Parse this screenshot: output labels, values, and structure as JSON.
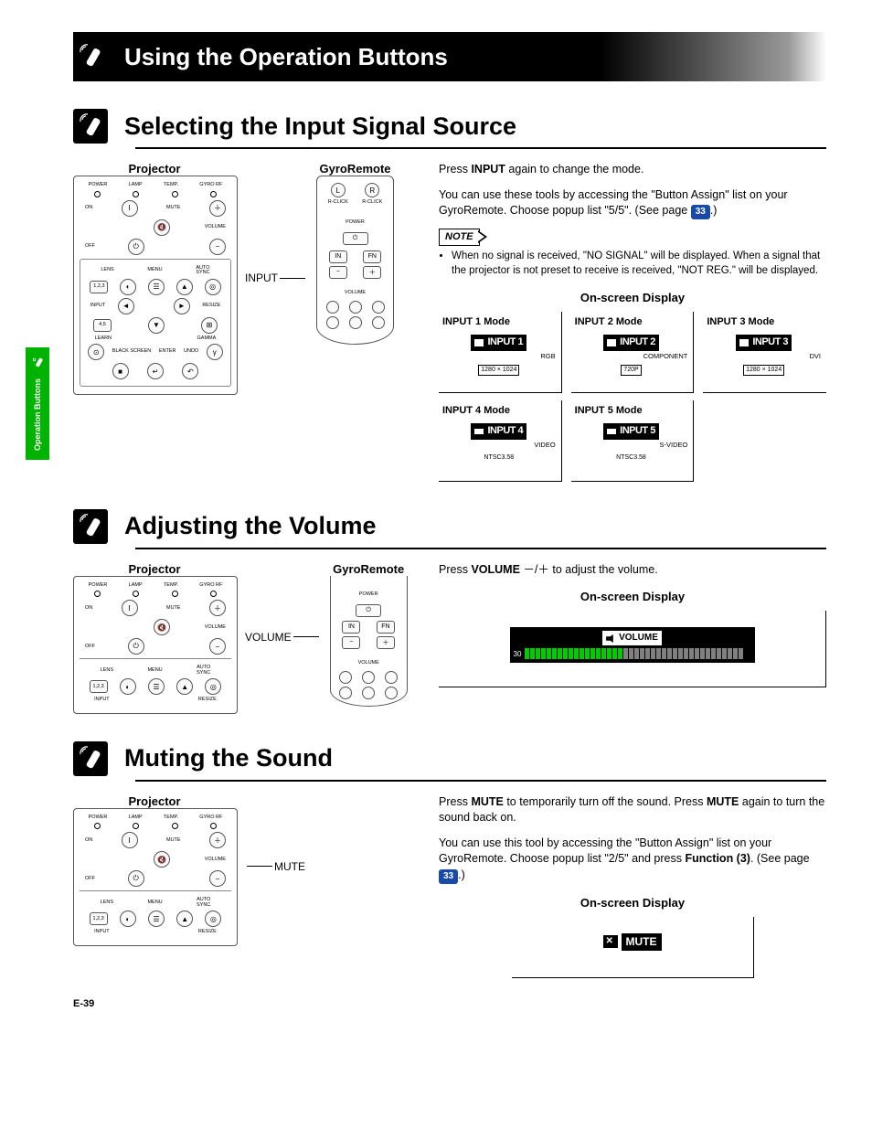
{
  "sideTab": "Operation Buttons",
  "mainTitle": "Using the Operation Buttons",
  "pageNum": "E-39",
  "pageRef": "33",
  "section1": {
    "title": "Selecting the Input Signal Source",
    "projectorLabel": "Projector",
    "remoteLabel": "GyroRemote",
    "pointer": "INPUT",
    "proj": {
      "ind": [
        "POWER",
        "LAMP",
        "TEMP.",
        "GYRO RF"
      ],
      "on": "ON",
      "mute": "MUTE",
      "volume": "VOLUME",
      "off": "OFF",
      "lens": "LENS",
      "menu": "MENU",
      "autosync": "AUTO\nSYNC",
      "input": "INPUT",
      "resize": "RESIZE",
      "learn": "LEARN",
      "gamma": "GAMMA",
      "black": "BLACK SCREEN",
      "enter": "ENTER",
      "undo": "UNDO",
      "n123": "1,2,3",
      "n45": "4,5"
    },
    "body": {
      "p1a": "Press ",
      "p1b": "INPUT",
      "p1c": " again to change the mode.",
      "p2": "You can use these tools by accessing the \"Button Assign\" list on your GyroRemote. Choose popup list \"5/5\". (See page ",
      "p2end": ".)",
      "note": "NOTE",
      "bullet": "When no signal is received, \"NO SIGNAL\" will be displayed. When a signal that the projector is not preset to receive is received, \"NOT REG.\" will be displayed.",
      "osdTitle": "On-screen Display",
      "modes": [
        {
          "head": "INPUT 1 Mode",
          "chip": "INPUT 1",
          "sub1": "RGB",
          "sub2": "1280 × 1024"
        },
        {
          "head": "INPUT 2 Mode",
          "chip": "INPUT 2",
          "sub1": "COMPONENT",
          "sub2": "720P"
        },
        {
          "head": "INPUT 3 Mode",
          "chip": "INPUT 3",
          "sub1": "DVI",
          "sub2": "1280 × 1024"
        },
        {
          "head": "INPUT 4 Mode",
          "chip": "INPUT 4",
          "sub1": "VIDEO",
          "sub2": "NTSC3.58"
        },
        {
          "head": "INPUT 5 Mode",
          "chip": "INPUT 5",
          "sub1": "S-VIDEO",
          "sub2": "NTSC3.58"
        }
      ]
    }
  },
  "section2": {
    "title": "Adjusting the Volume",
    "projectorLabel": "Projector",
    "remoteLabel": "GyroRemote",
    "pointer": "VOLUME",
    "body": {
      "p1a": "Press ",
      "p1b": "VOLUME ",
      "p1c": "－/＋",
      "p1d": " to adjust the volume.",
      "osdTitle": "On-screen Display",
      "volLabel": "VOLUME",
      "volNum": "30"
    }
  },
  "section3": {
    "title": "Muting the Sound",
    "projectorLabel": "Projector",
    "pointer": "MUTE",
    "body": {
      "p1a": "Press ",
      "p1b": "MUTE",
      "p1c": " to temporarily turn off the sound. Press ",
      "p1d": "MUTE",
      "p1e": " again to turn the sound back on.",
      "p2a": "You can use this tool by accessing the \"Button Assign\" list on your GyroRemote. Choose popup list \"2/5\" and press ",
      "p2b": "Function (3)",
      "p2c": ". (See page ",
      "p2d": ".)",
      "osdTitle": "On-screen Display",
      "muteLabel": "MUTE"
    }
  }
}
